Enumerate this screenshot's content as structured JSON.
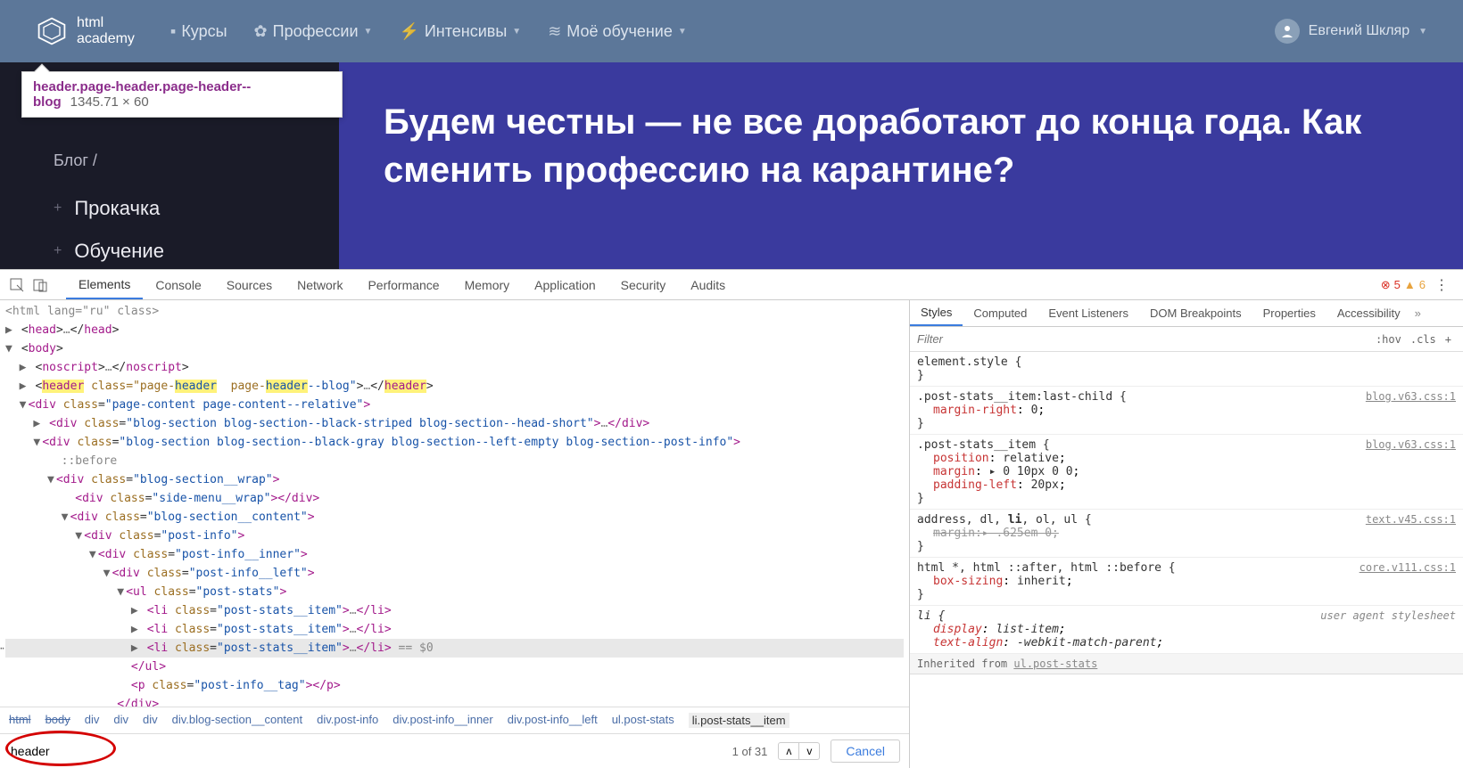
{
  "nav": {
    "logo_top": "html",
    "logo_bottom": "academy",
    "items": [
      "Курсы",
      "Профессии",
      "Интенсивы",
      "Моё обучение"
    ],
    "user": "Евгений Шкляр"
  },
  "tooltip": {
    "selector": "header.page-header.page-header--blog",
    "dims": "1345.71 × 60"
  },
  "sidebar": {
    "crumb": "Блог  /",
    "links": [
      "Прокачка",
      "Обучение"
    ]
  },
  "hero": {
    "title": "Будем честны — не все доработают до конца года. Как сменить профессию на карантине?"
  },
  "devtools": {
    "tabs": [
      "Elements",
      "Console",
      "Sources",
      "Network",
      "Performance",
      "Memory",
      "Application",
      "Security",
      "Audits"
    ],
    "active_tab": "Elements",
    "errors": "5",
    "warnings": "6",
    "dom": {
      "l0": "<html lang=\"ru\" class>",
      "head_open": "head",
      "head_close": "head",
      "body": "body",
      "noscript": "noscript",
      "header_tag": "header",
      "header_cls_pre": " class=\"page-",
      "header_hl": "header",
      "header_cls_mid": "  page-",
      "header_cls_end": "--blog\"",
      "div_pagecontent": "<div class=\"page-content page-content--relative\">",
      "div_blogshort": "<div class=\"blog-section blog-section--black-striped blog-section--head-short\">…</div>",
      "div_postinfo_sec": "<div class=\"blog-section blog-section--black-gray blog-section--left-empty blog-section--post-info\">",
      "before": "::before",
      "div_wrap": "<div class=\"blog-section__wrap\">",
      "div_sidemenu": "<div class=\"side-menu__wrap\"></div>",
      "div_content": "<div class=\"blog-section__content\">",
      "div_postinfo": "<div class=\"post-info\">",
      "div_inner": "<div class=\"post-info__inner\">",
      "div_left": "<div class=\"post-info__left\">",
      "ul_stats": "<ul class=\"post-stats\">",
      "li_item": "<li class=\"post-stats__item\">…</li>",
      "eqzero": " == $0",
      "ul_close": "</ul>",
      "p_tag": "<p class=\"post-info__tag\"></p>",
      "div_close": "</div>"
    },
    "crumbs": [
      "html",
      "body",
      "div",
      "div",
      "div",
      "div.blog-section__content",
      "div.post-info",
      "div.post-info__inner",
      "div.post-info__left",
      "ul.post-stats",
      "li.post-stats__item"
    ],
    "search": {
      "value": "header",
      "count": "1 of 31",
      "cancel": "Cancel"
    },
    "styles_tabs": [
      "Styles",
      "Computed",
      "Event Listeners",
      "DOM Breakpoints",
      "Properties",
      "Accessibility"
    ],
    "styles_active": "Styles",
    "filter_ph": "Filter",
    "hov": ":hov",
    "cls": ".cls",
    "rules": {
      "r0_sel": "element.style {",
      "r1_sel": ".post-stats__item:last-child {",
      "r1_link": "blog.v63.css:1",
      "r1_p1": "margin-right",
      "r1_v1": "0",
      "r2_sel": ".post-stats__item {",
      "r2_link": "blog.v63.css:1",
      "r2_p1": "position",
      "r2_v1": "relative",
      "r2_p2": "margin",
      "r2_v2": "▸ 0 10px 0 0",
      "r2_p3": "padding-left",
      "r2_v3": "20px",
      "r3_sel_a": "address, dl, ",
      "r3_sel_b": "li",
      "r3_sel_c": ", ol, ul {",
      "r3_link": "text.v45.css:1",
      "r3_p1": "margin:▸ .625em 0;",
      "r4_sel": "html *, html ::after, html ::before {",
      "r4_link": "core.v111.css:1",
      "r4_p1": "box-sizing",
      "r4_v1": "inherit",
      "r5_sel": "li {",
      "r5_ua": "user agent stylesheet",
      "r5_p1": "display",
      "r5_v1": "list-item",
      "r5_p2": "text-align",
      "r5_v2": "-webkit-match-parent",
      "inh_text": "Inherited from ",
      "inh_link": "ul.post-stats"
    }
  }
}
